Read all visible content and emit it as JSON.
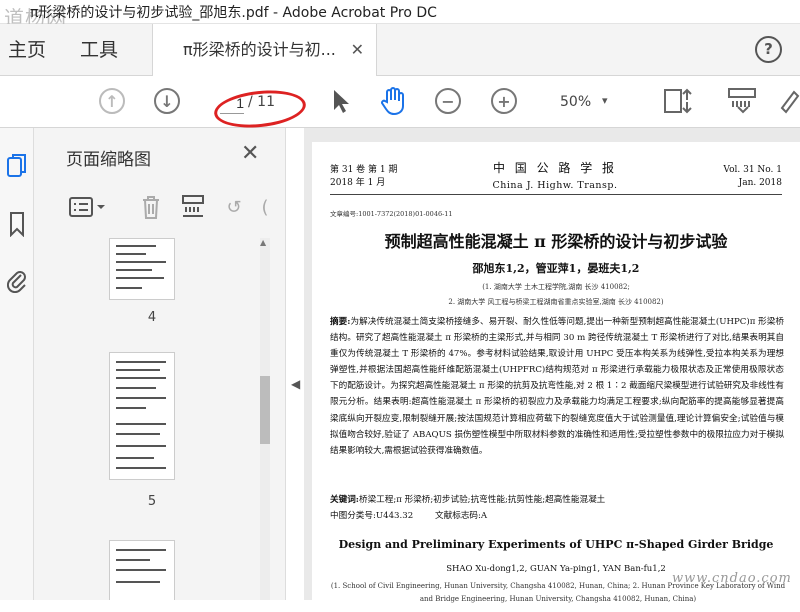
{
  "window": {
    "title": "π形梁桥的设计与初步试验_邵旭东.pdf - Adobe Acrobat Pro DC",
    "watermark_logo": "道杨网"
  },
  "tabs": {
    "home": "主页",
    "tools": "工具",
    "document": "π形梁桥的设计与初...",
    "close_glyph": "✕",
    "help_glyph": "?"
  },
  "toolbar": {
    "current_page": "1",
    "total_pages": "/ 11",
    "zoom": "50%",
    "zoom_caret": "▾",
    "icons": [
      "page-up-icon",
      "page-down-icon",
      "select-cursor-icon",
      "hand-tool-icon",
      "zoom-out-icon",
      "zoom-in-icon",
      "fit-page-icon",
      "scroll-mode-icon",
      "sign-icon"
    ]
  },
  "annotation": {
    "color": "#dd2222"
  },
  "side_panel": {
    "title": "页面缩略图",
    "close_glyph": "✕",
    "thumbnails": [
      {
        "label": "4"
      },
      {
        "label": "5"
      }
    ]
  },
  "document": {
    "header_left": [
      "第 31 卷  第 1 期",
      "2018 年 1 月"
    ],
    "header_mid_cn": "中 国 公 路 学 报",
    "header_mid_en": "China J. Highw. Transp.",
    "header_right": [
      "Vol. 31  No. 1",
      "Jan. 2018"
    ],
    "article_no": "文章编号:1001-7372(2018)01-0046-11",
    "title_cn": "预制超高性能混凝土 π 形梁桥的设计与初步试验",
    "authors_cn": "邵旭东1,2，管亚萍1，晏班夫1,2",
    "affil_cn_1": "(1. 湖南大学 土木工程学院,湖南 长沙  410082;",
    "affil_cn_2": "2. 湖南大学 风工程与桥梁工程湖南省重点实验室,湖南 长沙  410082)",
    "abstract_label": "摘要:",
    "abstract": "为解决传统混凝土简支梁桥接缝多、易开裂、耐久性低等问题,提出一种新型预制超高性能混凝土(UHPC)π 形梁桥结构。研究了超高性能混凝土 π 形梁桥的主梁形式,并与相同 30 m 跨径传统混凝土 T 形梁桥进行了对比,结果表明其自重仅为传统混凝土 T 形梁桥的 47%。参考材料试验结果,取设计用 UHPC 受压本构关系为线弹性,受拉本构关系为理想弹塑性,并根据法国超高性能纤维配筋混凝土(UHPFRC)结构规范对 π 形梁进行承载能力极限状态及正常使用极限状态下的配筋设计。为探究超高性能混凝土 π 形梁的抗剪及抗弯性能,对 2 根 1∶2 截面缩尺梁模型进行试验研究及非线性有限元分析。结果表明:超高性能混凝土 π 形梁桥的初裂应力及承载能力均满足工程要求;纵向配筋率的提高能够显著提高梁底纵向开裂应变,限制裂缝开展;按法国规范计算相应荷载下的裂缝宽度值大于试验测量值,理论计算偏安全;试验值与模拟值吻合较好,验证了 ABAQUS 损伤塑性模型中所取材料参数的准确性和适用性;受拉塑性参数中的极限拉应力对于模拟结果影响较大,需根据试验获得准确数值。",
    "keywords_label": "关键词:",
    "keywords": "桥梁工程;π 形梁桥;初步试验;抗弯性能;抗剪性能;超高性能混凝土",
    "clc_label": "中图分类号:",
    "clc": "U443.32",
    "doc_code_label": "文献标志码:",
    "doc_code": "A",
    "title_en": "Design and Preliminary Experiments of UHPC π-Shaped Girder Bridge",
    "authors_en": "SHAO Xu-dong1,2, GUAN Ya-ping1, YAN Ban-fu1,2",
    "affil_en": "(1. School of Civil Engineering, Hunan University, Changsha 410082, Hunan, China; 2. Hunan Province Key Laboratory of Wind and Bridge Engineering, Hunan University, Changsha 410082, Hunan, China)"
  },
  "watermark_footer": "www.cndao.com"
}
